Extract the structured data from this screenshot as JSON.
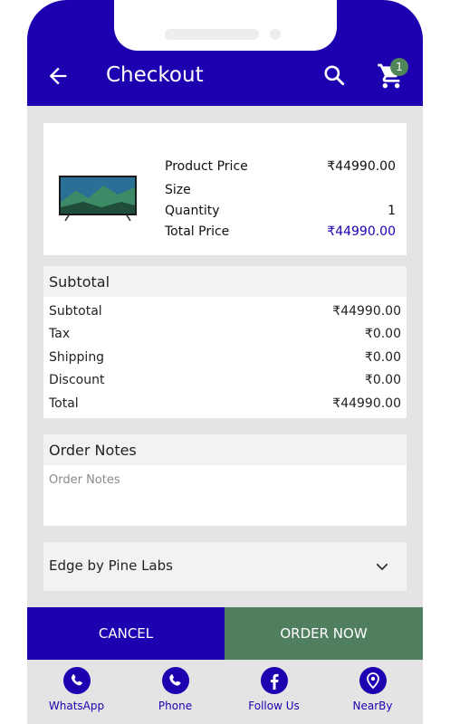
{
  "header": {
    "title": "Checkout",
    "cart_count": "1"
  },
  "product": {
    "rows": [
      {
        "label": "Product Price",
        "value": "₹44990.00"
      },
      {
        "label": "Size",
        "value": ""
      },
      {
        "label": "Quantity",
        "value": "1"
      },
      {
        "label": "Total Price",
        "value": "₹44990.00"
      }
    ]
  },
  "summary": {
    "title": "Subtotal",
    "rows": [
      {
        "label": "Subtotal",
        "value": "₹44990.00"
      },
      {
        "label": "Tax",
        "value": "₹0.00"
      },
      {
        "label": "Shipping",
        "value": "₹0.00"
      },
      {
        "label": "Discount",
        "value": "₹0.00"
      },
      {
        "label": "Total",
        "value": "₹44990.00"
      }
    ]
  },
  "notes": {
    "title": "Order Notes",
    "placeholder": "Order Notes"
  },
  "payment": {
    "selected": "Edge by Pine Labs"
  },
  "actions": {
    "cancel": "CANCEL",
    "order": "ORDER NOW"
  },
  "tabs": [
    {
      "label": "WhatsApp",
      "icon": "whatsapp-icon"
    },
    {
      "label": "Phone",
      "icon": "phone-icon"
    },
    {
      "label": "Follow Us",
      "icon": "facebook-icon"
    },
    {
      "label": "NearBy",
      "icon": "location-pin-icon"
    }
  ],
  "colors": {
    "primary": "#1f00b0",
    "accent": "#4f7f5f",
    "background": "#e4e4e4"
  }
}
